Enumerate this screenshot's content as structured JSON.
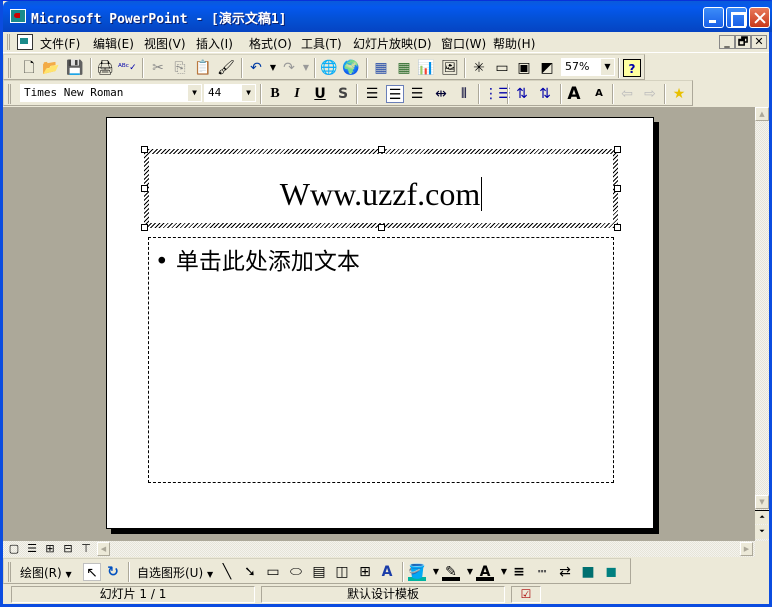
{
  "window": {
    "title": "Microsoft PowerPoint - [演示文稿1]"
  },
  "menubar": {
    "items": [
      {
        "label": "文件(F)"
      },
      {
        "label": "编辑(E)"
      },
      {
        "label": "视图(V)"
      },
      {
        "label": "插入(I)"
      },
      {
        "label": "格式(O)"
      },
      {
        "label": "工具(T)"
      },
      {
        "label": "幻灯片放映(D)"
      },
      {
        "label": "窗口(W)"
      },
      {
        "label": "帮助(H)"
      }
    ],
    "mdi_min": "_",
    "mdi_restore": "🗗",
    "mdi_close": "✕"
  },
  "standard_toolbar": {
    "zoom": "57%",
    "icons": [
      "new",
      "open",
      "save",
      "print",
      "spelling",
      "cut",
      "copy",
      "paste",
      "format-painter",
      "undo",
      "redo",
      "hyperlink",
      "web-toolbar",
      "insert-word-table",
      "insert-excel",
      "insert-chart",
      "insert-clipart",
      "new-slide",
      "slide-layout",
      "apply-design",
      "grayscale",
      "help"
    ]
  },
  "formatting_toolbar": {
    "font": "Times New Roman",
    "size": "44",
    "bold": "B",
    "italic": "I",
    "underline": "U",
    "shadow": "S"
  },
  "slide": {
    "title": "Www.uzzf.com",
    "body_placeholder": "单击此处添加文本",
    "bullet": "•"
  },
  "drawing_toolbar": {
    "draw_menu": "绘图(R)",
    "autoshapes_menu": "自选图形(U)",
    "fill_color": "#00b3a0",
    "line_color": "#000000",
    "font_color": "#000000"
  },
  "statusbar": {
    "slide_info": "幻灯片 1 / 1",
    "design": "默认设计模板"
  }
}
